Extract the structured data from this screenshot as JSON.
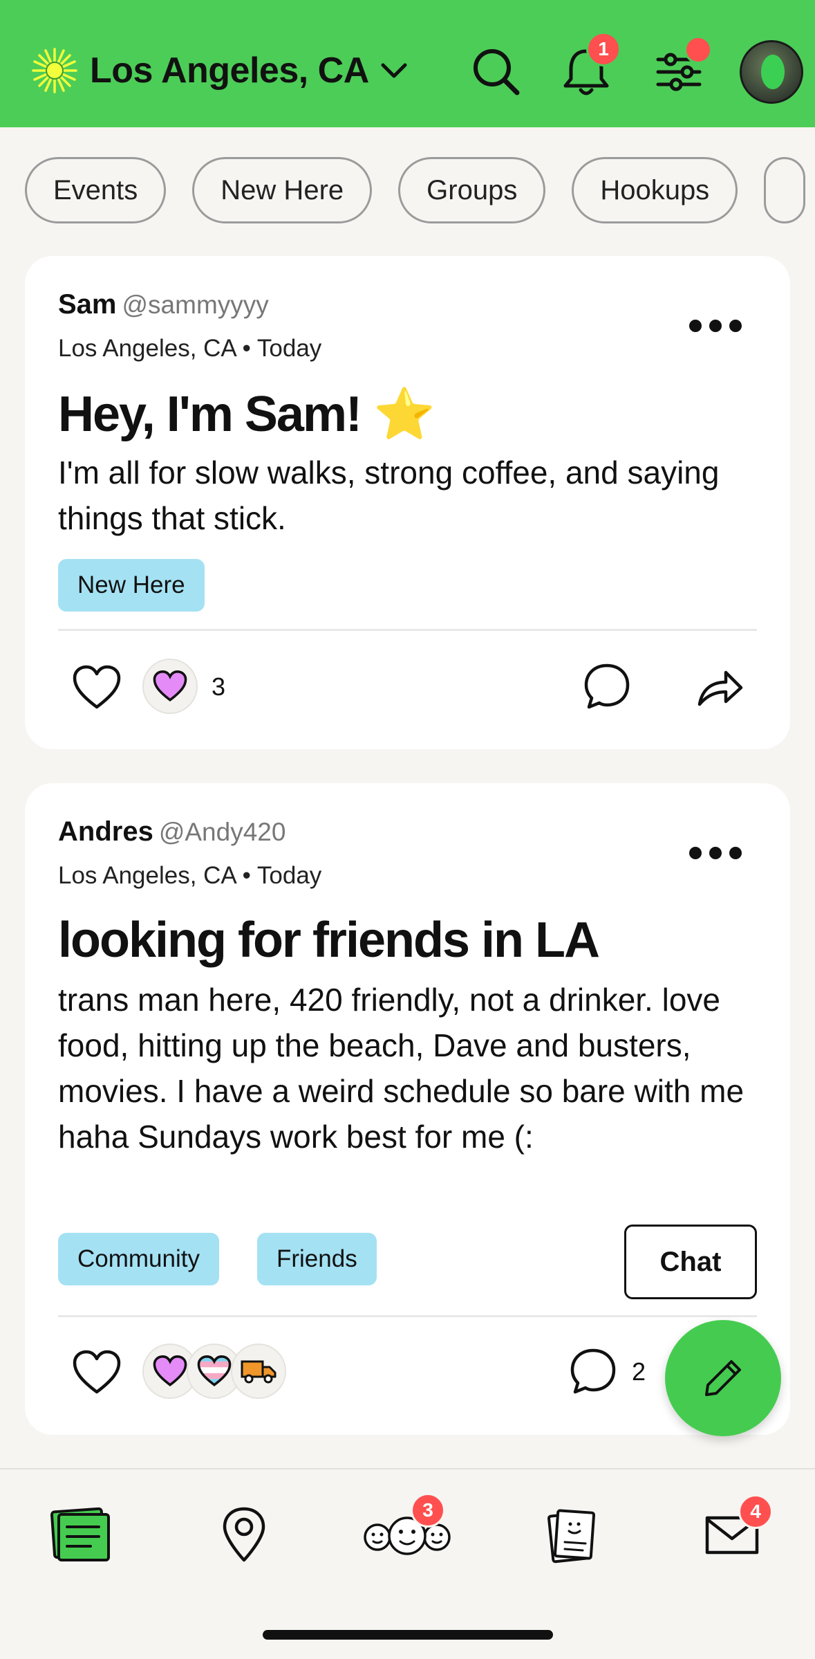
{
  "header": {
    "location": "Los Angeles, CA",
    "notification_count": "1",
    "bg_color": "#4ccd57"
  },
  "chips": [
    "Events",
    "New Here",
    "Groups",
    "Hookups"
  ],
  "posts": [
    {
      "author": "Sam",
      "handle": "@sammyyyy",
      "meta": "Los Angeles, CA • Today",
      "title": "Hey, I'm Sam! ⭐",
      "body": "I'm all for slow walks, strong coffee, and saying things that stick.",
      "tags": [
        "New Here"
      ],
      "reaction_count": "3",
      "reactions": [
        "purple-heart"
      ]
    },
    {
      "author": "Andres",
      "handle": "@Andy420",
      "meta": "Los Angeles, CA • Today",
      "title": "looking for friends in LA",
      "body": "trans man here, 420 friendly, not a drinker. love food, hitting up the beach, Dave and busters, movies. I have a weird schedule so bare with me haha Sundays work best for me (:",
      "tags": [
        "Community",
        "Friends"
      ],
      "chat_label": "Chat",
      "comment_count": "2",
      "reactions": [
        "purple-heart",
        "trans-heart",
        "truck"
      ]
    }
  ],
  "bottom_nav": {
    "people_badge": "3",
    "messages_badge": "4"
  }
}
